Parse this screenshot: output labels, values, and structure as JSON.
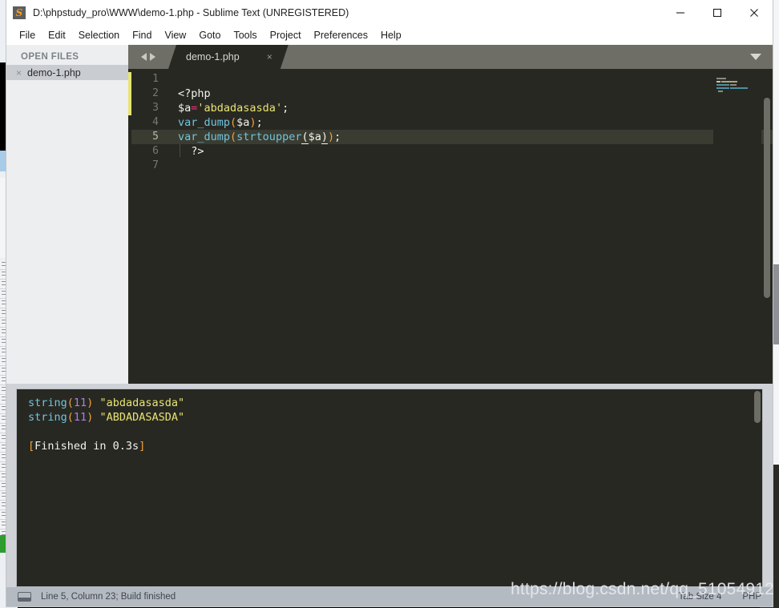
{
  "window": {
    "title": "D:\\phpstudy_pro\\WWW\\demo-1.php - Sublime Text (UNREGISTERED)",
    "app_icon": "S",
    "controls": {
      "minimize": "minimize-icon",
      "maximize": "maximize-icon",
      "close": "close-icon"
    }
  },
  "menubar": {
    "items": [
      {
        "label": "File"
      },
      {
        "label": "Edit"
      },
      {
        "label": "Selection"
      },
      {
        "label": "Find"
      },
      {
        "label": "View"
      },
      {
        "label": "Goto"
      },
      {
        "label": "Tools"
      },
      {
        "label": "Project"
      },
      {
        "label": "Preferences"
      },
      {
        "label": "Help"
      }
    ]
  },
  "sidebar": {
    "heading": "OPEN FILES",
    "files": [
      {
        "name": "demo-1.php",
        "close_glyph": "×"
      }
    ]
  },
  "tabbar": {
    "tabs": [
      {
        "label": "demo-1.php",
        "close_glyph": "×",
        "active": true
      }
    ]
  },
  "editor": {
    "line_numbers": [
      "1",
      "2",
      "3",
      "4",
      "5",
      "6",
      "7"
    ],
    "active_line": 5,
    "modified_lines": [
      3,
      4,
      5
    ],
    "lines": [
      {
        "n": 1,
        "tokens": []
      },
      {
        "n": 2,
        "tokens": [
          {
            "t": "<?php",
            "c": "tok-tag"
          }
        ]
      },
      {
        "n": 3,
        "tokens": [
          {
            "t": "$a",
            "c": "tok-var"
          },
          {
            "t": "=",
            "c": "tok-op"
          },
          {
            "t": "'abdadasasda'",
            "c": "tok-str"
          },
          {
            "t": ";",
            "c": "tok-var"
          }
        ]
      },
      {
        "n": 4,
        "tokens": [
          {
            "t": "var_dump",
            "c": "tok-fn"
          },
          {
            "t": "(",
            "c": "tok-punc"
          },
          {
            "t": "$a",
            "c": "tok-var"
          },
          {
            "t": ")",
            "c": "tok-punc"
          },
          {
            "t": ";",
            "c": "tok-var"
          }
        ]
      },
      {
        "n": 5,
        "tokens": [
          {
            "t": "var_dump",
            "c": "tok-fn"
          },
          {
            "t": "(",
            "c": "tok-punc"
          },
          {
            "t": "strtoupper",
            "c": "tok-fn"
          },
          {
            "t": "(",
            "c": "tok-match"
          },
          {
            "t": "$a",
            "c": "tok-var"
          },
          {
            "t": ")",
            "c": "tok-match"
          },
          {
            "t": ")",
            "c": "tok-punc"
          },
          {
            "t": ";",
            "c": "tok-var"
          }
        ]
      },
      {
        "n": 6,
        "tokens": [
          {
            "t": "  ?>",
            "c": "tok-tag"
          }
        ]
      },
      {
        "n": 7,
        "tokens": []
      }
    ],
    "plain_source": "\n<?php\n$a='abdadasasda';\nvar_dump($a);\nvar_dump(strtoupper($a));\n  ?>\n"
  },
  "output_panel": {
    "lines": [
      {
        "segments": [
          {
            "t": "string",
            "c": "out-type"
          },
          {
            "t": "(",
            "c": "out-paren"
          },
          {
            "t": "11",
            "c": "out-num"
          },
          {
            "t": ")",
            "c": "out-paren"
          },
          {
            "t": " ",
            "c": ""
          },
          {
            "t": "\"abdadasasda\"",
            "c": "out-str"
          }
        ]
      },
      {
        "segments": [
          {
            "t": "string",
            "c": "out-type"
          },
          {
            "t": "(",
            "c": "out-paren"
          },
          {
            "t": "11",
            "c": "out-num"
          },
          {
            "t": ")",
            "c": "out-paren"
          },
          {
            "t": " ",
            "c": ""
          },
          {
            "t": "\"ABDADASASDA\"",
            "c": "out-str"
          }
        ]
      },
      {
        "segments": []
      },
      {
        "segments": [
          {
            "t": "[",
            "c": "out-bracket"
          },
          {
            "t": "Finished in 0.3s",
            "c": ""
          },
          {
            "t": "]",
            "c": "out-bracket"
          }
        ]
      }
    ],
    "plain_text": "string(11) \"abdadasasda\"\nstring(11) \"ABDADASASDA\"\n\n[Finished in 0.3s]"
  },
  "statusbar": {
    "icon": "panel-icon",
    "text": "Line 5, Column 23; Build finished",
    "right": [
      {
        "label": "Tab Size 4"
      },
      {
        "label": "PHP"
      }
    ]
  },
  "watermark": {
    "text": "https://blog.csdn.net/qq_51054912"
  },
  "colors": {
    "editor_bg": "#282823",
    "sidebar_bg": "#eceef0",
    "tabbar_bg": "#6e6e66",
    "active_line_bg": "#3b3c31",
    "statusbar_bg": "#b4bac2",
    "modified_marker": "#e7e471",
    "function_blue": "#6ec5dd",
    "string_yellow": "#e7e471",
    "operator_pink": "#f0337a",
    "paren_orange": "#f3a33c",
    "number_purple": "#b07ce8"
  }
}
